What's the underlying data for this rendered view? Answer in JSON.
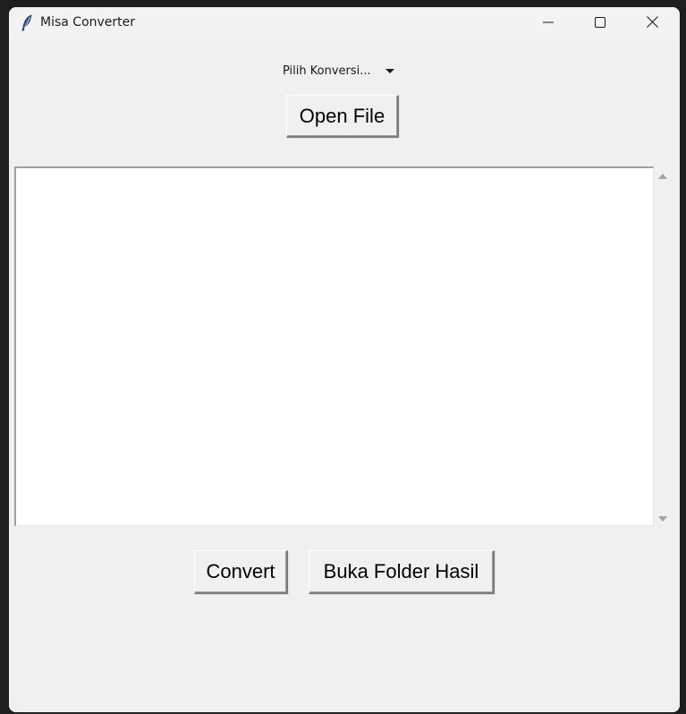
{
  "window": {
    "title": "Misa Converter",
    "icon": "feather-icon",
    "controls": {
      "minimize_icon": "minimize-icon",
      "maximize_icon": "maximize-icon",
      "close_icon": "close-icon"
    }
  },
  "toolbar": {
    "conversion_select": "Pilih Konversi...",
    "open_file_label": "Open File"
  },
  "output_text": {
    "value": ""
  },
  "actions": {
    "convert_label": "Convert",
    "open_folder_label": "Buka Folder Hasil"
  },
  "colors": {
    "window_bg": "#f0f0f0",
    "titlebar_bg": "#f3f3f3",
    "textarea_bg": "#ffffff"
  }
}
